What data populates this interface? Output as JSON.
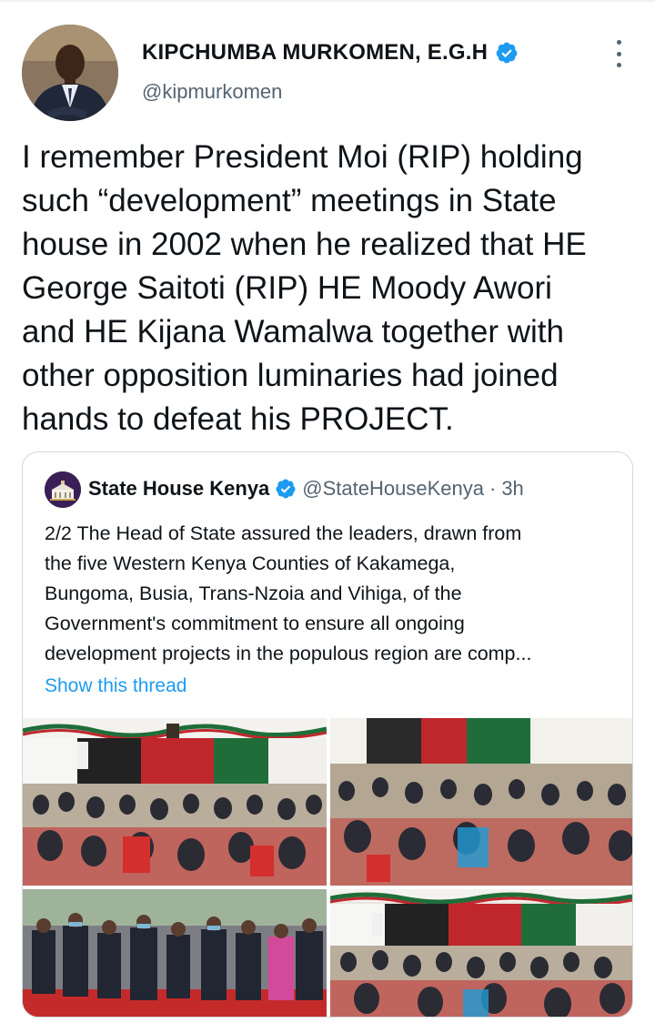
{
  "tweet": {
    "author_name": "KIPCHUMBA MURKOMEN, E.G.H",
    "author_handle": "@kipmurkomen",
    "text_lines": [
      "I remember President Moi (RIP) holding",
      "such “development” meetings in State",
      "house in 2002 when he realized that HE",
      "George Saitoti (RIP) HE Moody Awori",
      "and HE Kijana Wamalwa together with",
      "other opposition luminaries had joined",
      "hands to defeat his PROJECT."
    ]
  },
  "quote": {
    "author_name": "State House Kenya",
    "author_handle": "@StateHouseKenya",
    "separator": "·",
    "time": "3h",
    "text_lines": [
      "2/2 The Head of State assured the leaders, drawn from",
      "the five Western Kenya Counties of Kakamega,",
      "Bungoma, Busia, Trans-Nzoia and Vihiga, of the",
      "Government's commitment to ensure all ongoing",
      "development projects in the populous region are comp..."
    ],
    "show_thread": "Show this thread"
  },
  "colors": {
    "verified": "#1d9bf0",
    "link": "#1d9bf0",
    "secondary_text": "#536471",
    "border": "#cfd9de"
  },
  "icons": {
    "verified": "verified-badge-icon",
    "more": "more-options-icon"
  }
}
